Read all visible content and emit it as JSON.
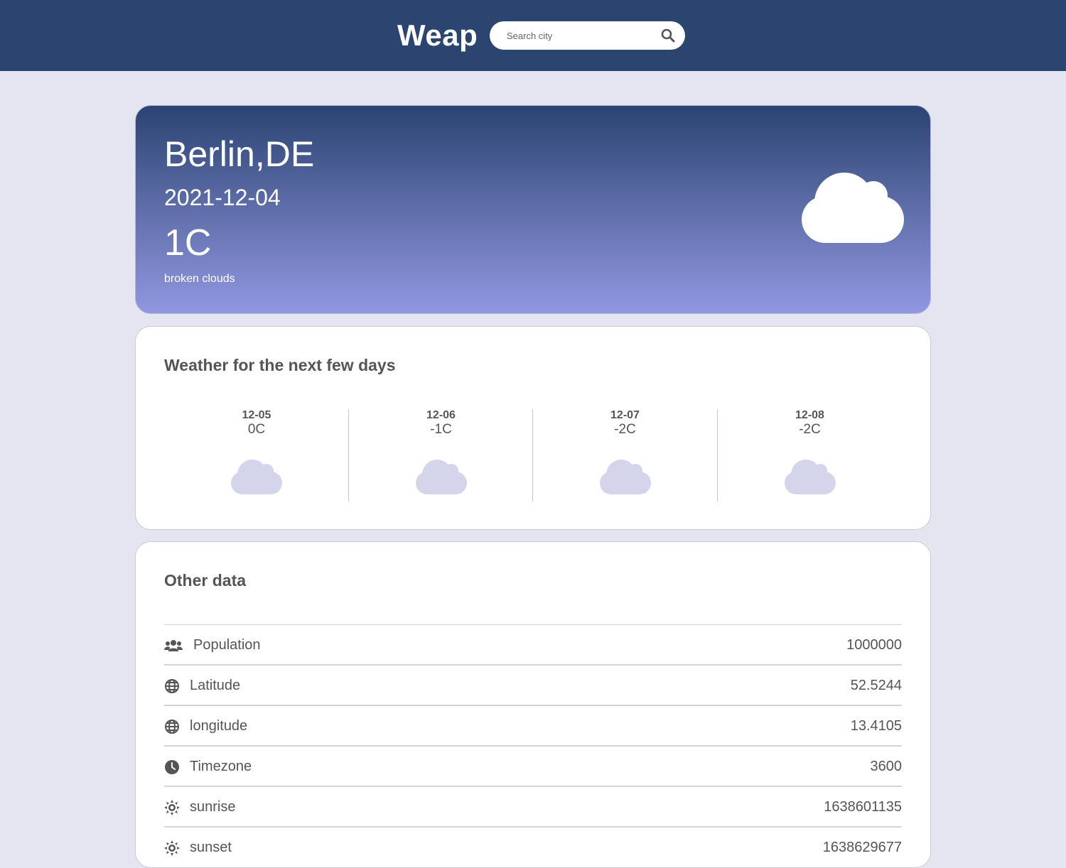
{
  "header": {
    "logo": "Weap",
    "search": {
      "placeholder": "Search city",
      "value": ""
    },
    "search_icon": "search-icon"
  },
  "current": {
    "city": "Berlin,DE",
    "date": "2021-12-04",
    "temperature": "1C",
    "description": "broken clouds",
    "icon": "cloud-icon"
  },
  "forecast": {
    "title": "Weather for the next few days",
    "days": [
      {
        "date": "12-05",
        "temp": "0C",
        "icon": "cloud-icon"
      },
      {
        "date": "12-06",
        "temp": "-1C",
        "icon": "cloud-icon"
      },
      {
        "date": "12-07",
        "temp": "-2C",
        "icon": "cloud-icon"
      },
      {
        "date": "12-08",
        "temp": "-2C",
        "icon": "cloud-icon"
      }
    ]
  },
  "other": {
    "title": "Other data",
    "rows": [
      {
        "label": "Population",
        "value": "1000000",
        "icon": "users-icon"
      },
      {
        "label": "Latitude",
        "value": "52.5244",
        "icon": "globe-icon"
      },
      {
        "label": "longitude",
        "value": "13.4105",
        "icon": "globe-icon"
      },
      {
        "label": "Timezone",
        "value": "3600",
        "icon": "clock-icon"
      },
      {
        "label": "sunrise",
        "value": "1638601135",
        "icon": "sun-icon"
      },
      {
        "label": "sunset",
        "value": "1638629677",
        "icon": "sun-icon"
      }
    ]
  },
  "colors": {
    "header_bg": "#2c4570",
    "page_bg": "#e5e5f1",
    "hero_gradient_top": "#2b4472",
    "hero_gradient_bottom": "#9197e0",
    "forecast_cloud": "#d4d5ea",
    "text": "#555555"
  }
}
